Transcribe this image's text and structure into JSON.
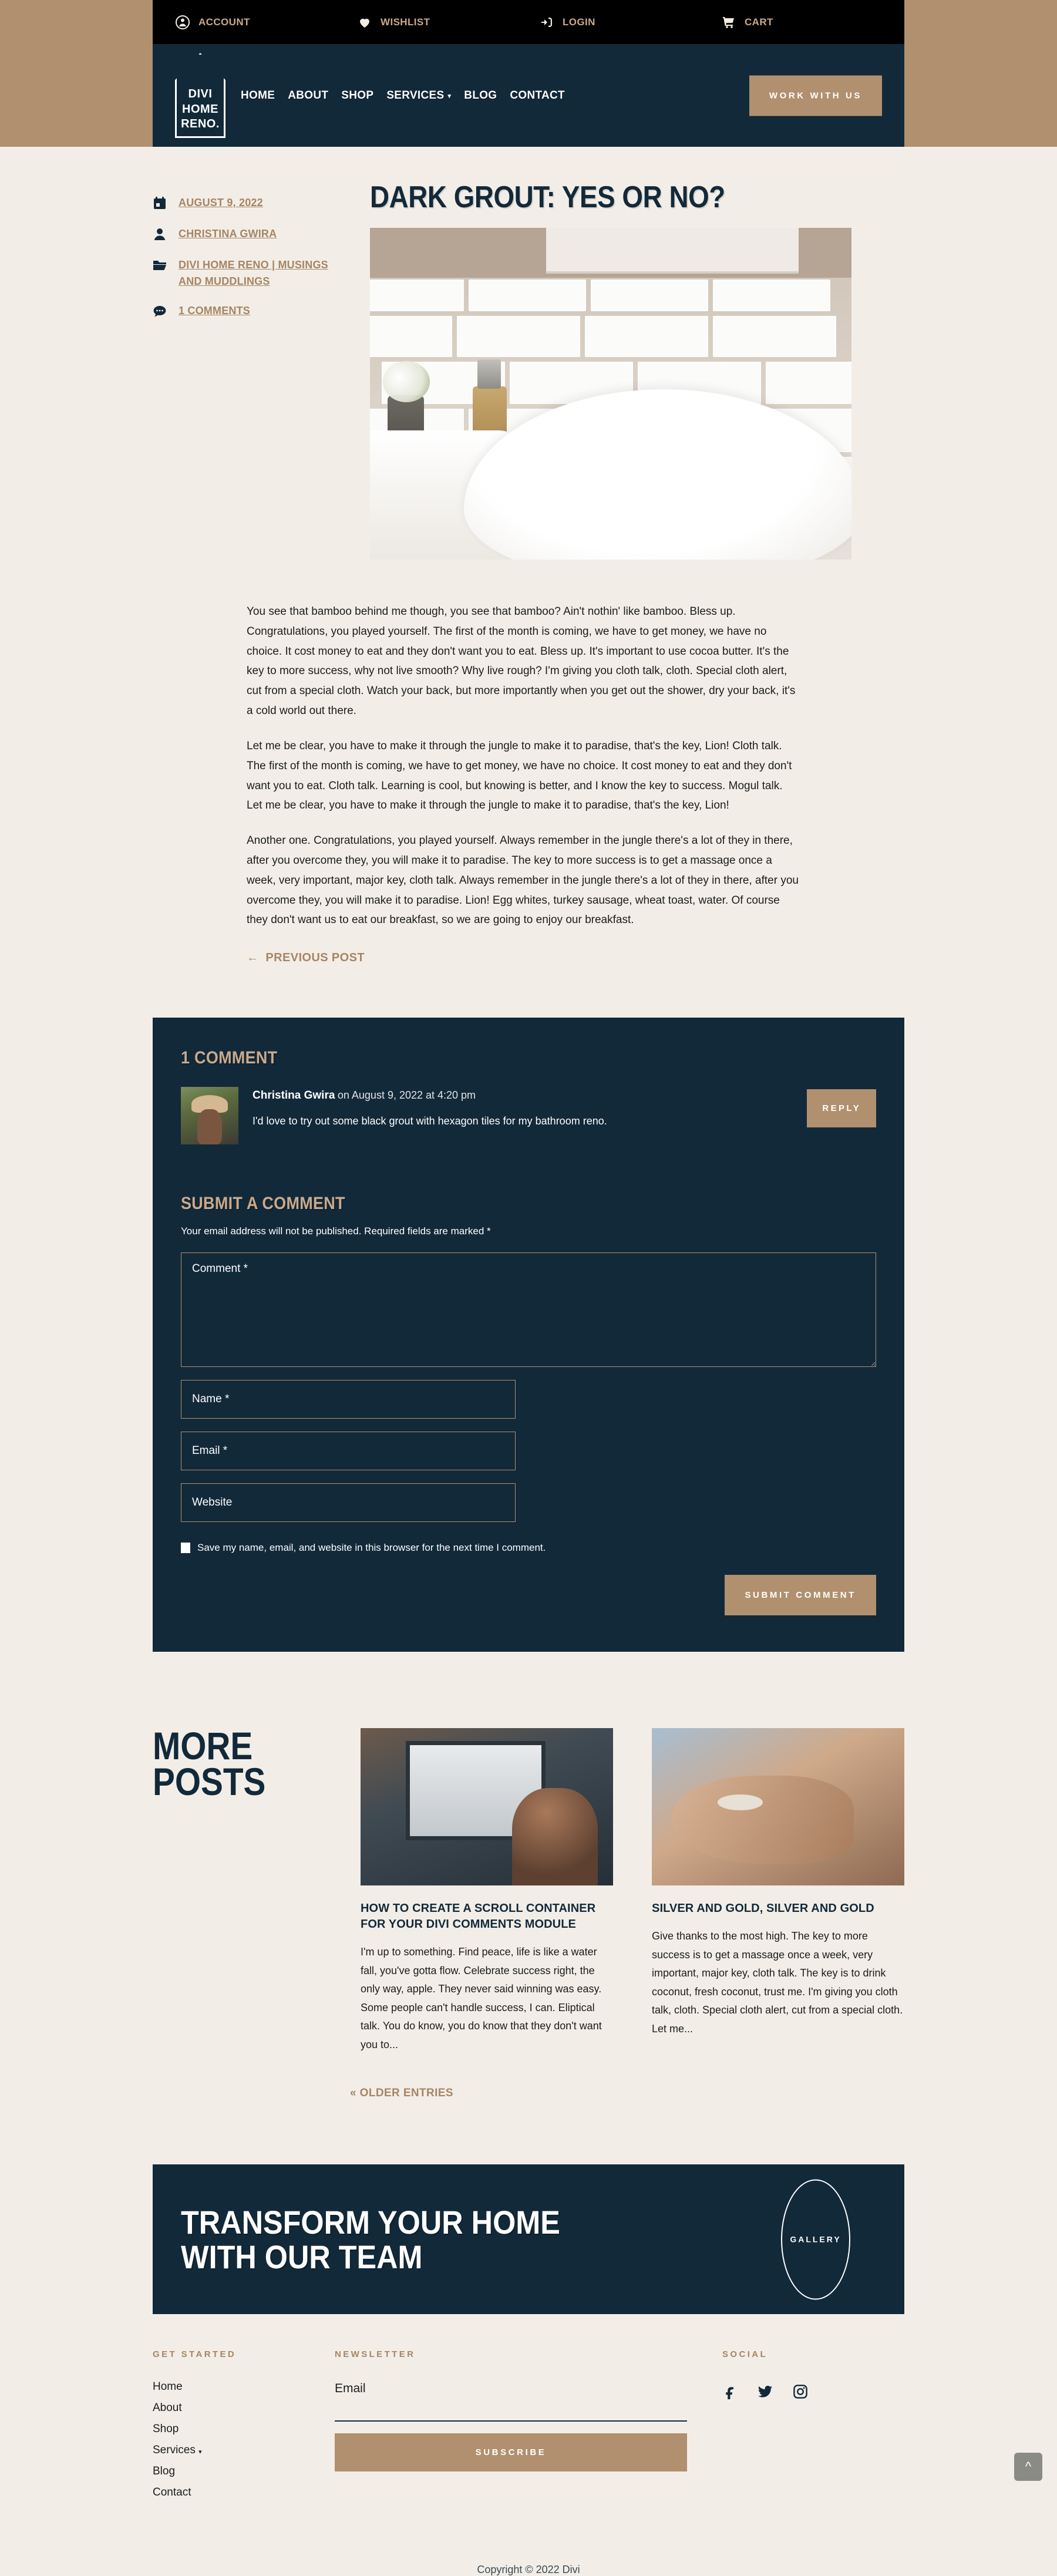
{
  "topbar": {
    "items": [
      {
        "label": "ACCOUNT",
        "icon": "account-icon"
      },
      {
        "label": "WISHLIST",
        "icon": "heart-icon"
      },
      {
        "label": "LOGIN",
        "icon": "login-icon"
      },
      {
        "label": "CART",
        "icon": "cart-icon"
      }
    ]
  },
  "nav": {
    "logo_text": "DIVI\nHOME\nRENO.",
    "logo_line1": "DIVI",
    "logo_line2": "HOME",
    "logo_line3": "RENO.",
    "links": [
      {
        "label": "HOME",
        "has_dropdown": false
      },
      {
        "label": "ABOUT",
        "has_dropdown": false
      },
      {
        "label": "SHOP",
        "has_dropdown": false
      },
      {
        "label": "SERVICES",
        "has_dropdown": true
      },
      {
        "label": "BLOG",
        "has_dropdown": false
      },
      {
        "label": "CONTACT",
        "has_dropdown": false
      }
    ],
    "cta_label": "WORK WITH US"
  },
  "post": {
    "title": "DARK GROUT: YES OR NO?",
    "meta": {
      "date": "AUGUST 9, 2022",
      "author": "CHRISTINA GWIRA",
      "categories": "DIVI HOME RENO | MUSINGS AND MUDDLINGS",
      "comments": "1 COMMENTS"
    },
    "paragraphs": [
      "You see that bamboo behind me though, you see that bamboo? Ain't nothin' like bamboo. Bless up. Congratulations, you played yourself. The first of the month is coming, we have to get money, we have no choice. It cost money to eat and they don't want you to eat. Bless up. It's important to use cocoa butter. It's the key to more success, why not live smooth? Why live rough? I'm giving you cloth talk, cloth. Special cloth alert, cut from a special cloth. Watch your back, but more importantly when you get out the shower, dry your back, it's a cold world out there.",
      "Let me be clear, you have to make it through the jungle to make it to paradise, that's the key, Lion! Cloth talk. The first of the month is coming, we have to get money, we have no choice. It cost money to eat and they don't want you to eat. Cloth talk. Learning is cool, but knowing is better, and I know the key to success. Mogul talk. Let me be clear, you have to make it through the jungle to make it to paradise, that's the key, Lion!",
      "Another one. Congratulations, you played yourself. Always remember in the jungle there's a lot of they in there, after you overcome they, you will make it to paradise. The key to more success is to get a massage once a week, very important, major key, cloth talk. Always remember in the jungle there's a lot of they in there, after you overcome they, you will make it to paradise. Lion! Egg whites, turkey sausage, wheat toast, water. Of course they don't want us to eat our breakfast, so we are going to enjoy our breakfast."
    ],
    "previous_post_label": "PREVIOUS POST",
    "previous_post_arrow": "←"
  },
  "comments": {
    "heading": "1 COMMENT",
    "items": [
      {
        "author": "Christina Gwira",
        "date": "on August 9, 2022 at 4:20 pm",
        "text": "I'd love to try out some black grout with hexagon tiles for my bathroom reno.",
        "reply_label": "REPLY"
      }
    ],
    "form": {
      "heading": "SUBMIT A COMMENT",
      "note": "Your email address will not be published. Required fields are marked *",
      "comment_placeholder": "Comment *",
      "name_placeholder": "Name *",
      "email_placeholder": "Email *",
      "website_placeholder": "Website",
      "save_label": "Save my name, email, and website in this browser for the next time I comment.",
      "submit_label": "SUBMIT COMMENT"
    }
  },
  "more_posts": {
    "heading_line1": "MORE",
    "heading_line2": "POSTS",
    "older_entries_label": "« OLDER ENTRIES",
    "cards": [
      {
        "title": "HOW TO CREATE A SCROLL CONTAINER FOR YOUR DIVI COMMENTS MODULE",
        "excerpt": "I'm up to something. Find peace, life is like a water fall, you've gotta flow. Celebrate success right, the only way, apple. They never said winning was easy. Some people can't handle success, I can. Eliptical talk. You do know, you do know that they don't want you to...",
        "image": "office-desk-photo"
      },
      {
        "title": "SILVER AND GOLD, SILVER AND GOLD",
        "excerpt": "Give thanks to the most high. The key to more success is to get a massage once a week, very important, major key, cloth talk. The key is to drink coconut, fresh coconut, trust me. I'm giving you cloth talk, cloth. Special cloth alert, cut from a special cloth. Let me...",
        "image": "hands-jewelry-photo"
      }
    ]
  },
  "banner": {
    "line1": "TRANSFORM YOUR HOME",
    "line2": "WITH OUR TEAM",
    "badge_label": "GALLERY"
  },
  "footer": {
    "get_started_heading": "GET STARTED",
    "links": [
      {
        "label": "Home",
        "has_dropdown": false
      },
      {
        "label": "About",
        "has_dropdown": false
      },
      {
        "label": "Shop",
        "has_dropdown": false
      },
      {
        "label": "Services",
        "has_dropdown": true
      },
      {
        "label": "Blog",
        "has_dropdown": false
      },
      {
        "label": "Contact",
        "has_dropdown": false
      }
    ],
    "newsletter_heading": "NEWSLETTER",
    "email_label": "Email",
    "subscribe_label": "SUBSCRIBE",
    "social_heading": "SOCIAL",
    "socials": [
      "facebook-icon",
      "twitter-icon",
      "instagram-icon"
    ],
    "copyright": "Copyright © 2022 Divi"
  },
  "colors": {
    "navy": "#12293a",
    "tan": "#b1906f",
    "cream": "#f2eee7",
    "black": "#000000"
  }
}
